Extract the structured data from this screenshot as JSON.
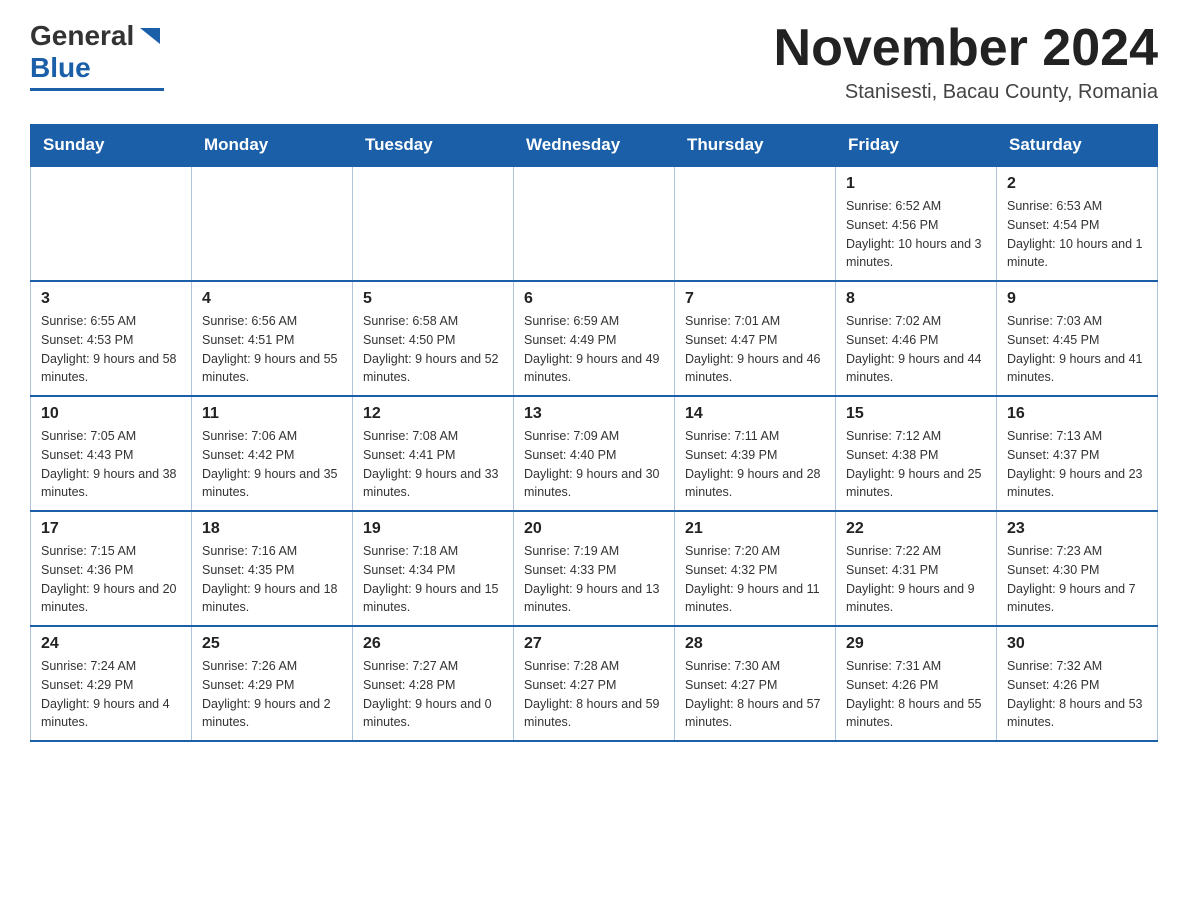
{
  "header": {
    "month_title": "November 2024",
    "subtitle": "Stanisesti, Bacau County, Romania",
    "logo_general": "General",
    "logo_blue": "Blue"
  },
  "days_of_week": [
    "Sunday",
    "Monday",
    "Tuesday",
    "Wednesday",
    "Thursday",
    "Friday",
    "Saturday"
  ],
  "weeks": [
    {
      "days": [
        {
          "number": "",
          "info": ""
        },
        {
          "number": "",
          "info": ""
        },
        {
          "number": "",
          "info": ""
        },
        {
          "number": "",
          "info": ""
        },
        {
          "number": "",
          "info": ""
        },
        {
          "number": "1",
          "info": "Sunrise: 6:52 AM\nSunset: 4:56 PM\nDaylight: 10 hours and 3 minutes."
        },
        {
          "number": "2",
          "info": "Sunrise: 6:53 AM\nSunset: 4:54 PM\nDaylight: 10 hours and 1 minute."
        }
      ]
    },
    {
      "days": [
        {
          "number": "3",
          "info": "Sunrise: 6:55 AM\nSunset: 4:53 PM\nDaylight: 9 hours and 58 minutes."
        },
        {
          "number": "4",
          "info": "Sunrise: 6:56 AM\nSunset: 4:51 PM\nDaylight: 9 hours and 55 minutes."
        },
        {
          "number": "5",
          "info": "Sunrise: 6:58 AM\nSunset: 4:50 PM\nDaylight: 9 hours and 52 minutes."
        },
        {
          "number": "6",
          "info": "Sunrise: 6:59 AM\nSunset: 4:49 PM\nDaylight: 9 hours and 49 minutes."
        },
        {
          "number": "7",
          "info": "Sunrise: 7:01 AM\nSunset: 4:47 PM\nDaylight: 9 hours and 46 minutes."
        },
        {
          "number": "8",
          "info": "Sunrise: 7:02 AM\nSunset: 4:46 PM\nDaylight: 9 hours and 44 minutes."
        },
        {
          "number": "9",
          "info": "Sunrise: 7:03 AM\nSunset: 4:45 PM\nDaylight: 9 hours and 41 minutes."
        }
      ]
    },
    {
      "days": [
        {
          "number": "10",
          "info": "Sunrise: 7:05 AM\nSunset: 4:43 PM\nDaylight: 9 hours and 38 minutes."
        },
        {
          "number": "11",
          "info": "Sunrise: 7:06 AM\nSunset: 4:42 PM\nDaylight: 9 hours and 35 minutes."
        },
        {
          "number": "12",
          "info": "Sunrise: 7:08 AM\nSunset: 4:41 PM\nDaylight: 9 hours and 33 minutes."
        },
        {
          "number": "13",
          "info": "Sunrise: 7:09 AM\nSunset: 4:40 PM\nDaylight: 9 hours and 30 minutes."
        },
        {
          "number": "14",
          "info": "Sunrise: 7:11 AM\nSunset: 4:39 PM\nDaylight: 9 hours and 28 minutes."
        },
        {
          "number": "15",
          "info": "Sunrise: 7:12 AM\nSunset: 4:38 PM\nDaylight: 9 hours and 25 minutes."
        },
        {
          "number": "16",
          "info": "Sunrise: 7:13 AM\nSunset: 4:37 PM\nDaylight: 9 hours and 23 minutes."
        }
      ]
    },
    {
      "days": [
        {
          "number": "17",
          "info": "Sunrise: 7:15 AM\nSunset: 4:36 PM\nDaylight: 9 hours and 20 minutes."
        },
        {
          "number": "18",
          "info": "Sunrise: 7:16 AM\nSunset: 4:35 PM\nDaylight: 9 hours and 18 minutes."
        },
        {
          "number": "19",
          "info": "Sunrise: 7:18 AM\nSunset: 4:34 PM\nDaylight: 9 hours and 15 minutes."
        },
        {
          "number": "20",
          "info": "Sunrise: 7:19 AM\nSunset: 4:33 PM\nDaylight: 9 hours and 13 minutes."
        },
        {
          "number": "21",
          "info": "Sunrise: 7:20 AM\nSunset: 4:32 PM\nDaylight: 9 hours and 11 minutes."
        },
        {
          "number": "22",
          "info": "Sunrise: 7:22 AM\nSunset: 4:31 PM\nDaylight: 9 hours and 9 minutes."
        },
        {
          "number": "23",
          "info": "Sunrise: 7:23 AM\nSunset: 4:30 PM\nDaylight: 9 hours and 7 minutes."
        }
      ]
    },
    {
      "days": [
        {
          "number": "24",
          "info": "Sunrise: 7:24 AM\nSunset: 4:29 PM\nDaylight: 9 hours and 4 minutes."
        },
        {
          "number": "25",
          "info": "Sunrise: 7:26 AM\nSunset: 4:29 PM\nDaylight: 9 hours and 2 minutes."
        },
        {
          "number": "26",
          "info": "Sunrise: 7:27 AM\nSunset: 4:28 PM\nDaylight: 9 hours and 0 minutes."
        },
        {
          "number": "27",
          "info": "Sunrise: 7:28 AM\nSunset: 4:27 PM\nDaylight: 8 hours and 59 minutes."
        },
        {
          "number": "28",
          "info": "Sunrise: 7:30 AM\nSunset: 4:27 PM\nDaylight: 8 hours and 57 minutes."
        },
        {
          "number": "29",
          "info": "Sunrise: 7:31 AM\nSunset: 4:26 PM\nDaylight: 8 hours and 55 minutes."
        },
        {
          "number": "30",
          "info": "Sunrise: 7:32 AM\nSunset: 4:26 PM\nDaylight: 8 hours and 53 minutes."
        }
      ]
    }
  ]
}
